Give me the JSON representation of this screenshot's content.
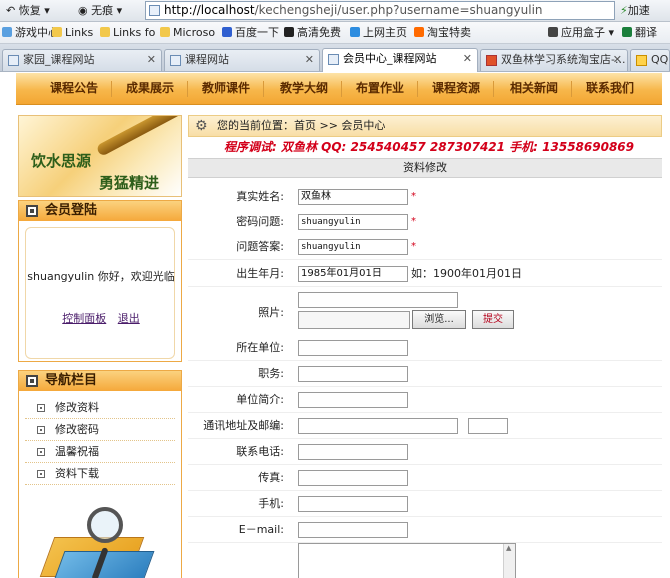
{
  "browser": {
    "back_label": "恢复",
    "forward_label": "无痕",
    "url_host": "http://localhost",
    "url_path": "/kechengsheji/user.php?username=shuangyulin",
    "speed_label": "加速",
    "bookmarks": [
      {
        "label": "游戏中心"
      },
      {
        "label": "Links"
      },
      {
        "label": "Links fo"
      },
      {
        "label": "Microso"
      },
      {
        "label": "百度一下"
      },
      {
        "label": "高清免费"
      },
      {
        "label": "上网主页"
      },
      {
        "label": "淘宝特卖"
      },
      {
        "label": "应用盒子"
      },
      {
        "label": "翻译"
      }
    ],
    "tabs": [
      {
        "label": "家园_课程网站"
      },
      {
        "label": "课程网站"
      },
      {
        "label": "会员中心_课程网站"
      },
      {
        "label": "双鱼林学习系统淘宝店-..."
      },
      {
        "label": "QQ"
      }
    ]
  },
  "site_nav": [
    "课程公告",
    "成果展示",
    "教师课件",
    "教学大纲",
    "布置作业",
    "课程资源",
    "相关新闻",
    "联系我们"
  ],
  "banner": {
    "line1": "饮水思源",
    "line2": "勇猛精进"
  },
  "member_box": {
    "title": "会员登陆",
    "welcome": "shuangyulin 你好，欢迎光临",
    "control_link": "控制面板",
    "logout_link": "退出"
  },
  "nav_box": {
    "title": "导航栏目",
    "items": [
      "修改资料",
      "修改密码",
      "温馨祝福",
      "资料下载"
    ]
  },
  "breadcrumb": {
    "text": "您的当前位置：首页 >> 会员中心"
  },
  "debug_line": "程序调试: 双鱼林 QQ: 254540457 287307421 手机: 13558690869",
  "form": {
    "title": "资料修改",
    "realname_label": "真实姓名:",
    "realname_value": "双鱼林",
    "question_label": "密码问题:",
    "question_value": "shuangyulin",
    "answer_label": "问题答案:",
    "answer_value": "shuangyulin",
    "birth_label": "出生年月:",
    "birth_value": "1985年01月01日",
    "birth_hint": "如：1900年01月01日",
    "photo_label": "照片:",
    "browse_label": "浏览...",
    "submit_label": "提交",
    "unit_label": "所在单位:",
    "job_label": "职务:",
    "unitintro_label": "单位简介:",
    "address_label": "通讯地址及邮编:",
    "phone_label": "联系电话:",
    "fax_label": "传真:",
    "mobile_label": "手机:",
    "email_label": "E－mail:",
    "required_mark": "*"
  }
}
